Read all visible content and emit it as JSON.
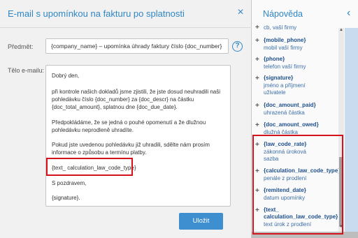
{
  "modal": {
    "title": "E-mail s upomínkou na fakturu po splatnosti",
    "close_glyph": "×",
    "subject_label": "Předmět:",
    "subject_value": "{company_name} – upomínka úhrady faktury číslo {doc_number}",
    "body_label": "Tělo e-mailu:",
    "body": {
      "greeting": "Dobrý den,",
      "p1": "při kontrole našich dokladů jsme zjistili, že jste dosud neuhradili naši pohledávku číslo {doc_number} za {doc_descr} na částku {doc_total_amount}, splatnou dne {doc_due_date}.",
      "p2": "Předpokládáme, že se jedná o pouhé opomenutí a že dlužnou pohledávku neprodleně uhradíte.",
      "p3": "Pokud jste uvedenou pohledávku již uhradili, sdělte nám prosím informace o způsobu a termínu platby.",
      "placeholder_line": "{text_ calculation_law_code_type}",
      "closing": " S pozdravem,",
      "signature": "{signature}."
    },
    "save_label": "Uložit",
    "help_glyph": "?"
  },
  "help": {
    "title": "Nápověda",
    "chevron_glyph": "‹",
    "items": [
      {
        "code": "",
        "desc": "cb, vaší firmy"
      },
      {
        "code": "{mobile_phone}",
        "desc": "mobil vaší firmy"
      },
      {
        "code": "{phone}",
        "desc": "telefon vaší firmy"
      },
      {
        "code": "{signature}",
        "desc": "jméno a příjmení",
        "desc2": "uživatele"
      },
      {
        "code": "{doc_amount_paid}",
        "desc": "uhrazená částka"
      },
      {
        "code": "{doc_amount_owed}",
        "desc": "dlužná částka"
      },
      {
        "code": "{law_code_rate}",
        "desc": "zákonná úroková",
        "desc2": "sazba"
      },
      {
        "code": "{calculation_law_code_type}",
        "desc": "penále z prodlení"
      },
      {
        "code": "{remitend_date}",
        "desc": "datum upomínky"
      },
      {
        "code": "{text_",
        "code2": "calculation_law_code_type}",
        "desc": "text úrok z prodlení"
      }
    ]
  },
  "colors": {
    "accent": "#2f86c6",
    "highlight": "#d41219",
    "button": "#3e8fd0"
  }
}
